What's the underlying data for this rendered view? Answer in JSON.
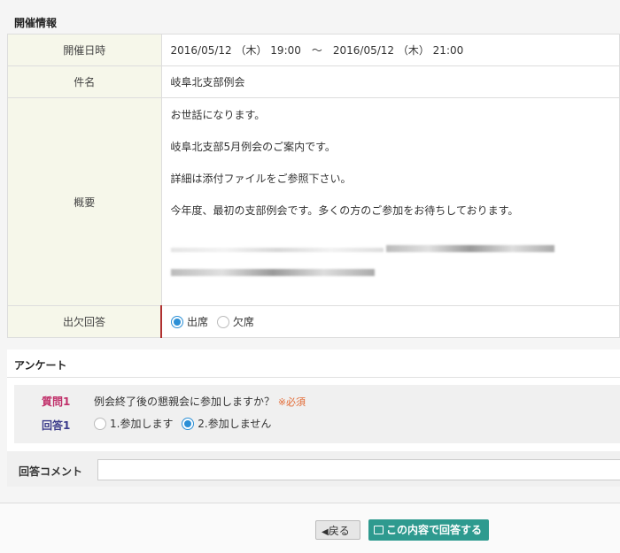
{
  "event_section": {
    "title": "開催情報"
  },
  "event": {
    "datetime_label": "開催日時",
    "datetime_value": "2016/05/12 （木） 19:00　～　2016/05/12 （木） 21:00",
    "subject_label": "件名",
    "subject_value": "岐阜北支部例会",
    "overview_label": "概要",
    "overview_lines": [
      "お世話になります。",
      "岐阜北支部5月例会のご案内です。",
      "詳細は添付ファイルをご参照下さい。",
      "今年度、最初の支部例会です。多くの方のご参加をお待ちしております。"
    ],
    "attendance_label": "出欠回答",
    "attendance_options": [
      "出席",
      "欠席"
    ],
    "attendance_selected": "出席"
  },
  "survey_section": {
    "title": "アンケート"
  },
  "survey": {
    "question_label": "質問1",
    "question_text": "例会終了後の懇親会に参加しますか？",
    "required_mark": "※必須",
    "answer_label": "回答1",
    "answer_options": [
      "1.参加します",
      "2.参加しません"
    ],
    "answer_selected": "2.参加しません"
  },
  "comment": {
    "label": "回答コメント",
    "value": ""
  },
  "buttons": {
    "back_label": "戻る",
    "submit_label": "この内容で回答する"
  },
  "colors": {
    "accent": "#2b8fd6",
    "submit_bg": "#2e9a8f",
    "question_label": "#c0306a",
    "required": "#e26a35"
  }
}
